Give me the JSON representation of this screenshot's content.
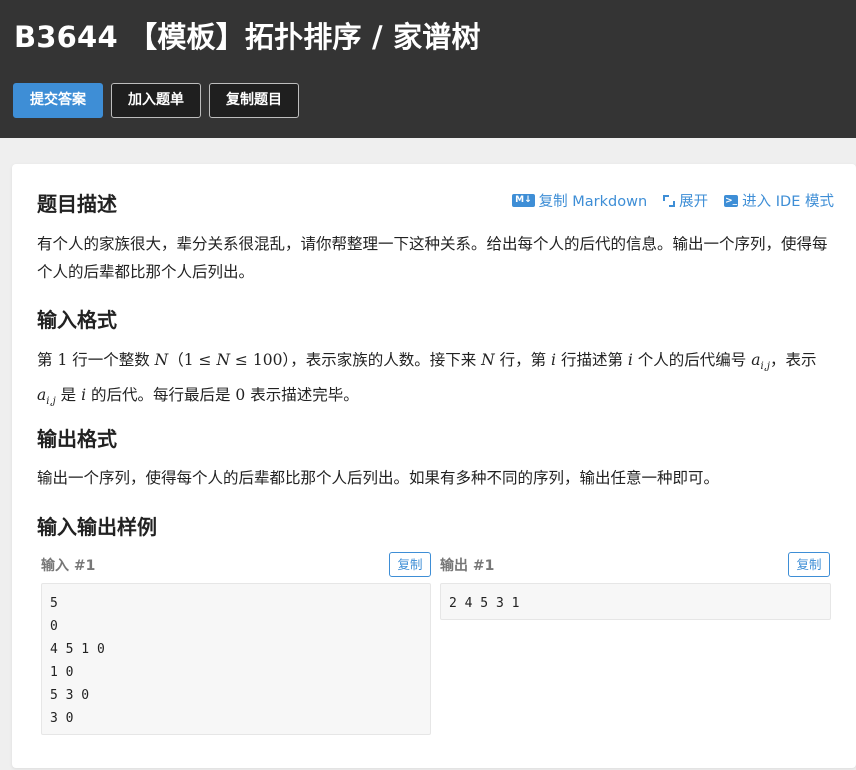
{
  "header": {
    "title": "B3644 【模板】拓扑排序 / 家谱树",
    "buttons": {
      "submit": "提交答案",
      "add_to_list": "加入题单",
      "copy_problem": "复制题目"
    }
  },
  "toolbar": {
    "copy_markdown": "复制 Markdown",
    "expand": "展开",
    "ide_mode": "进入 IDE 模式",
    "icons": [
      "markdown-icon",
      "expand-icon",
      "terminal-icon"
    ]
  },
  "description": {
    "title": "题目描述",
    "text": "有个人的家族很大，辈分关系很混乱，请你帮整理一下这种关系。给出每个人的后代的信息。输出一个序列，使得每个人的后辈都比那个人后列出。"
  },
  "input_format": {
    "title": "输入格式",
    "part1": "第 ",
    "num1": "1",
    "part2": " 行一个整数 ",
    "var_n": "N",
    "range": "（1 ≤ ",
    "range_var": "N",
    "range_end": " ≤ 100）",
    "part3": "，表示家族的人数。接下来 ",
    "var_n2": "N",
    "part4": " 行，第 ",
    "var_i": "i",
    "part5": " 行描述第 ",
    "var_i2": "i",
    "part6": " 个人的后代编号 ",
    "var_a": "a",
    "sub_ij": "i,j",
    "part7": "，表示 ",
    "var_a2": "a",
    "sub_ij2": "i,j",
    "part8": " 是 ",
    "var_i3": "i",
    "part9": " 的后代。每行最后是 ",
    "num0": "0",
    "part10": " 表示描述完毕。"
  },
  "output_format": {
    "title": "输出格式",
    "text": "输出一个序列，使得每个人的后辈都比那个人后列出。如果有多种不同的序列，输出任意一种即可。"
  },
  "samples": {
    "title": "输入输出样例",
    "input_label": "输入 #1",
    "output_label": "输出 #1",
    "copy_label": "复制",
    "input_text": "5\n0\n4 5 1 0\n1 0\n5 3 0\n3 0",
    "output_text": "2 4 5 3 1"
  },
  "colors": {
    "header_bg": "#343434",
    "accent": "#3e8ed6",
    "page_bg": "#efefef"
  }
}
